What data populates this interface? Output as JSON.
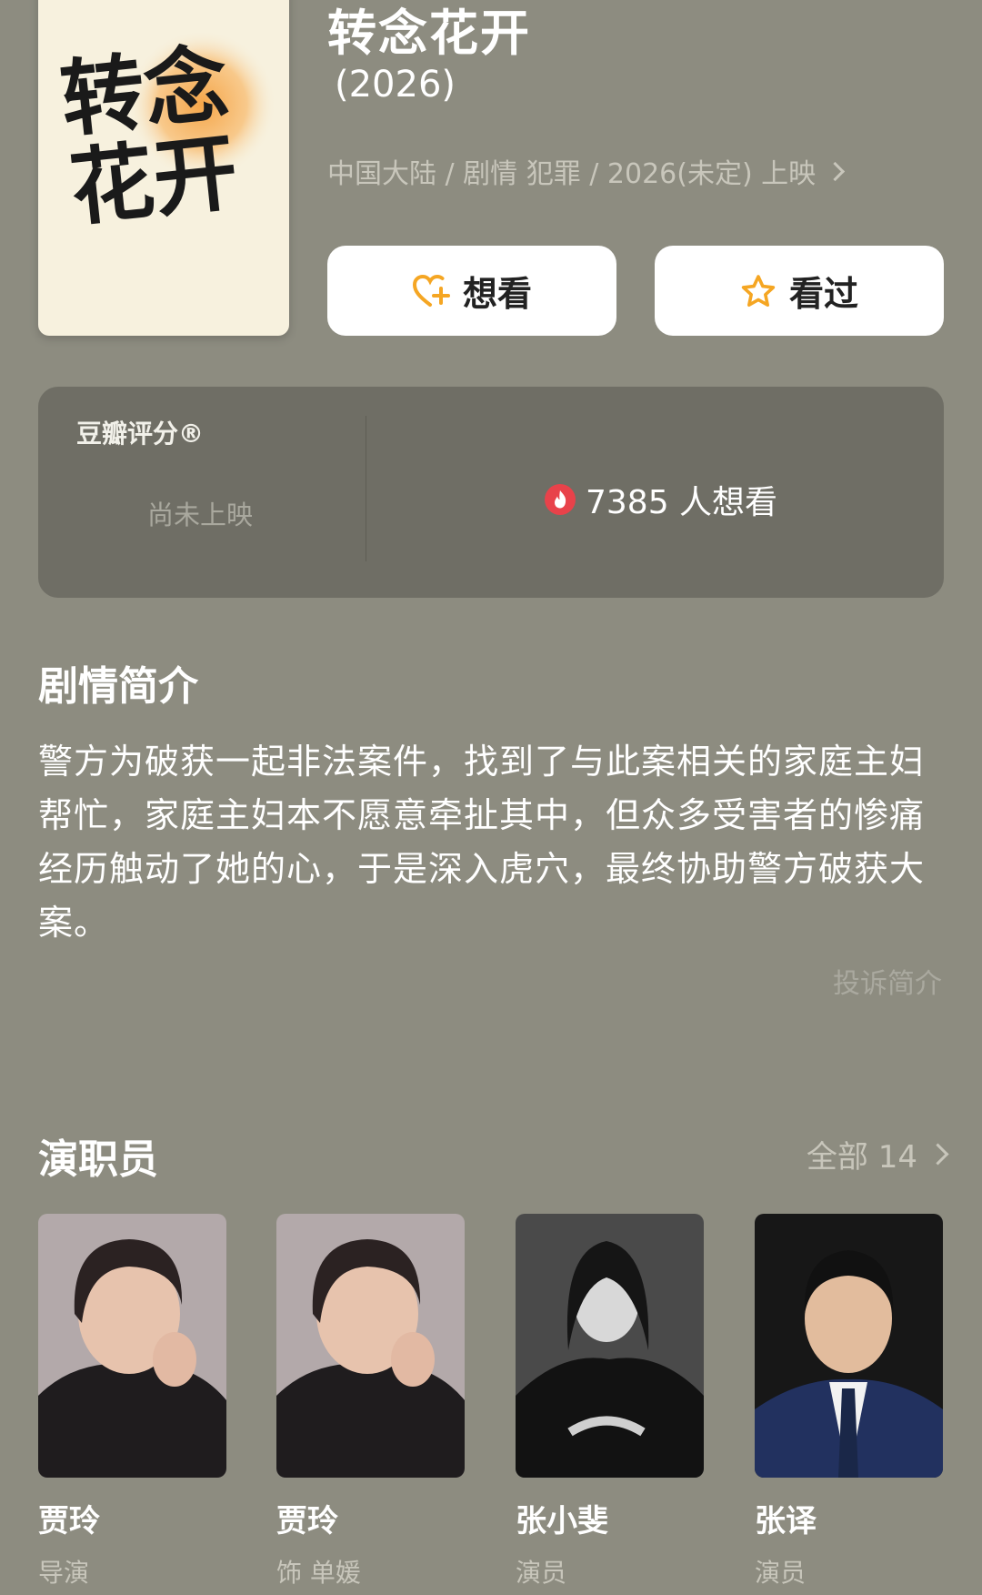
{
  "poster": {
    "calligraphy": "转念花开"
  },
  "movie": {
    "title": "转念花开",
    "year": "(2026)",
    "meta": "中国大陆 / 剧情 犯罪 / 2026(未定) 上映"
  },
  "actions": {
    "want_label": "想看",
    "seen_label": "看过"
  },
  "rating": {
    "label": "豆瓣评分®",
    "status": "尚未上映",
    "want_count_text": "7385 人想看"
  },
  "intro": {
    "title": "剧情简介",
    "text": "警方为破获一起非法案件，找到了与此案相关的家庭主妇帮忙，家庭主妇本不愿意牵扯其中，但众多受害者的惨痛经历触动了她的心，于是深入虎穴，最终协助警方破获大案。",
    "report_label": "投诉简介"
  },
  "cast": {
    "title": "演职员",
    "all_label": "全部 14",
    "members": [
      {
        "name": "贾玲",
        "role": "导演"
      },
      {
        "name": "贾玲",
        "role": "饰 单媛"
      },
      {
        "name": "张小斐",
        "role": "演员"
      },
      {
        "name": "张译",
        "role": "演员"
      }
    ]
  },
  "colors": {
    "background": "#8d8c80",
    "card": "#6f6e65",
    "accent_orange": "#f5a623",
    "fire_red": "#e8424a"
  }
}
